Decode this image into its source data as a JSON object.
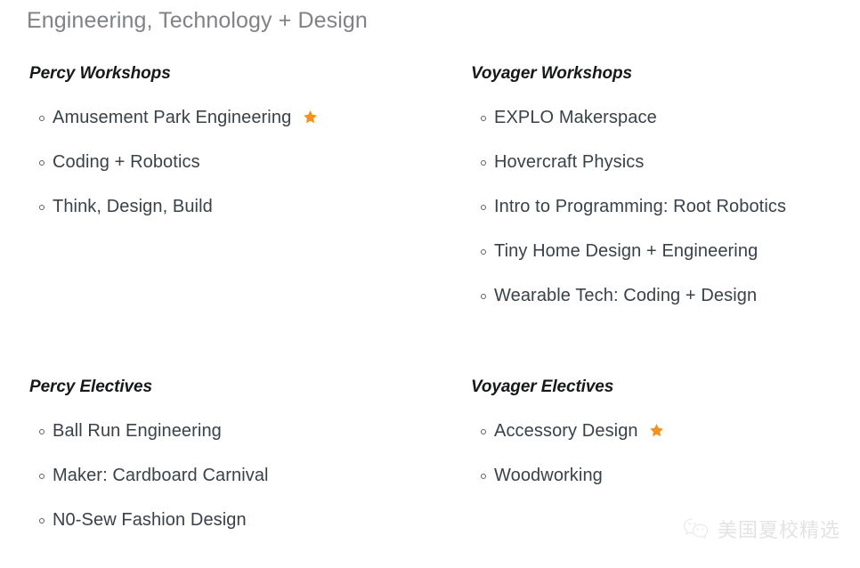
{
  "page": {
    "title": "Engineering, Technology + Design",
    "title_color": "#808285",
    "background_color": "#ffffff",
    "text_color": "#3a4148",
    "heading_color": "#16181a",
    "star_color": "#F5921E"
  },
  "columns": {
    "left": {
      "workshops": {
        "heading": "Percy Workshops",
        "items": [
          {
            "label": "Amusement Park Engineering",
            "starred": true
          },
          {
            "label": "Coding + Robotics",
            "starred": false
          },
          {
            "label": "Think, Design, Build",
            "starred": false
          }
        ]
      },
      "electives": {
        "heading": "Percy Electives",
        "items": [
          {
            "label": "Ball Run Engineering",
            "starred": false
          },
          {
            "label": "Maker: Cardboard Carnival",
            "starred": false
          },
          {
            "label": "N0-Sew Fashion Design",
            "starred": false
          }
        ]
      }
    },
    "right": {
      "workshops": {
        "heading": "Voyager Workshops",
        "items": [
          {
            "label": "EXPLO Makerspace",
            "starred": false
          },
          {
            "label": "Hovercraft Physics",
            "starred": false
          },
          {
            "label": "Intro to Programming: Root Robotics",
            "starred": false
          },
          {
            "label": "Tiny Home Design + Engineering",
            "starred": false
          },
          {
            "label": "Wearable Tech: Coding + Design",
            "starred": false
          }
        ]
      },
      "electives": {
        "heading": "Voyager Electives",
        "items": [
          {
            "label": "Accessory Design",
            "starred": true
          },
          {
            "label": "Woodworking",
            "starred": false
          }
        ]
      }
    }
  },
  "watermark": {
    "icon": "wechat-logo-icon",
    "text": "美国夏校精选",
    "color": "#e2e2e2"
  }
}
